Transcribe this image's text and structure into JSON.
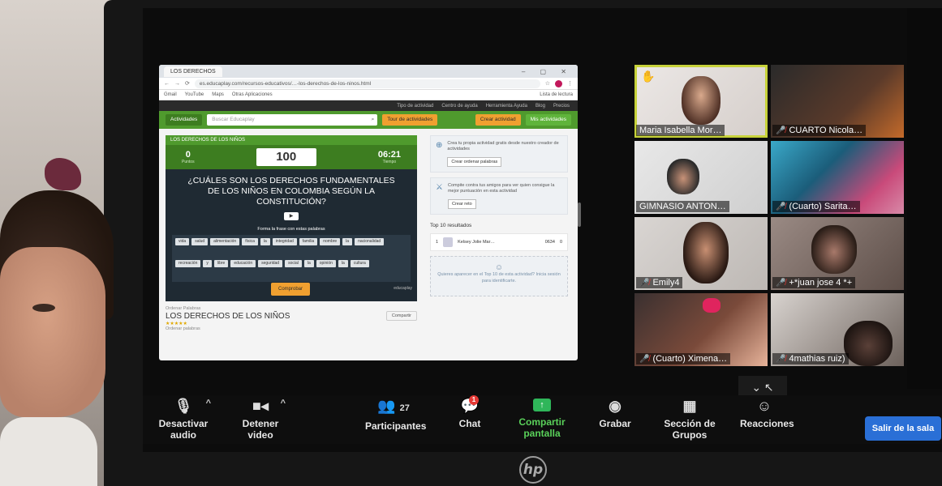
{
  "browser": {
    "tab_label": "LOS DERECHOS",
    "address": "es.educaplay.com/recursos-educativos/…-los-derechos-de-los-ninos.html",
    "bookmarks": [
      "Gmail",
      "YouTube",
      "Maps",
      "Otras Aplicaciones"
    ],
    "bookmarks_right": "Lista de lectura",
    "site_nav": [
      "Tipo de actividad",
      "Centro de ayuda",
      "Herramienta Ayuda",
      "Blog",
      "Precios"
    ],
    "site_bar": {
      "left_button": "Actividades",
      "search_placeholder": "Buscar Educaplay",
      "btn_1": "Tour de actividades",
      "btn_2": "Crear actividad",
      "btn_3": "Mis actividades"
    }
  },
  "game": {
    "header": "LOS DERECHOS DE LOS NIÑOS",
    "left_score": "0",
    "left_sub": "Puntos",
    "center_score": "100",
    "right_score": "06:21",
    "right_sub": "Tiempo",
    "question": "¿CUÁLES SON LOS DERECHOS FUNDAMENTALES DE LOS NIÑOS EN COLOMBIA SEGÚN LA CONSTITUCIÓN?",
    "play_icon": "play-icon",
    "instruction": "Forma la frase con estas palabras",
    "words": [
      "vida",
      "salud",
      "alimentación",
      "física",
      "la",
      "integridad",
      "familia",
      "nombre",
      "la",
      "nacionalidad",
      "recreación",
      "y",
      "libre",
      "educación",
      "seguridad",
      "social",
      "la",
      "opinión",
      "la",
      "cultura"
    ],
    "check_label": "Comprobar",
    "footer": "educaplay"
  },
  "meta": {
    "type": "Ordenar Palabras",
    "title": "LOS DERECHOS DE LOS NIÑOS",
    "share": "Compartir",
    "stars": "★★★★★",
    "category": "Ordenar palabras"
  },
  "side": {
    "card1_text": "Crea tu propia actividad gratis desde nuestro creador de actividades",
    "card1_btn": "Crear ordenar palabras",
    "card2_text": "Compite contra tus amigos para ver quien consigue la mejor puntuación en esta actividad",
    "card2_btn": "Crear reto",
    "top_title": "Top 10 resultados",
    "rank": {
      "pos": "1",
      "name": "Kelsey Jolie Mar…",
      "score": "0634",
      "time": "0"
    },
    "empty_text": "Quieres aparecer en el Top 10 de esta actividad? Inicia sesión para identificarte."
  },
  "participants": [
    {
      "name": "Maria Isabella Mor…",
      "muted": false,
      "speaking": true,
      "hand": true
    },
    {
      "name": "CUARTO Nicola…",
      "muted": true
    },
    {
      "name": "GIMNASIO ANTON…",
      "muted": false
    },
    {
      "name": "(Cuarto) Sarita…",
      "muted": true
    },
    {
      "name": "Emily4",
      "muted": true
    },
    {
      "name": "+*juan jose 4 *+",
      "muted": true
    },
    {
      "name": "(Cuarto) Ximena…",
      "muted": true
    },
    {
      "name": "4mathias ruiz)",
      "muted": true
    }
  ],
  "toolbar": {
    "audio": "Desactivar audio",
    "video": "Detener video",
    "participants": "Participantes",
    "participants_count": "27",
    "chat": "Chat",
    "chat_badge": "1",
    "share": "Compartir pantalla",
    "record": "Grabar",
    "groups": "Sección de Grupos",
    "reactions": "Reacciones",
    "leave": "Salir de la sala"
  },
  "brand": "hp",
  "colors": {
    "accent_green": "#4f9a2d",
    "speaker_outline": "#c7d23a",
    "leave_blue": "#2a6fd6",
    "share_green": "#2fb65a"
  }
}
